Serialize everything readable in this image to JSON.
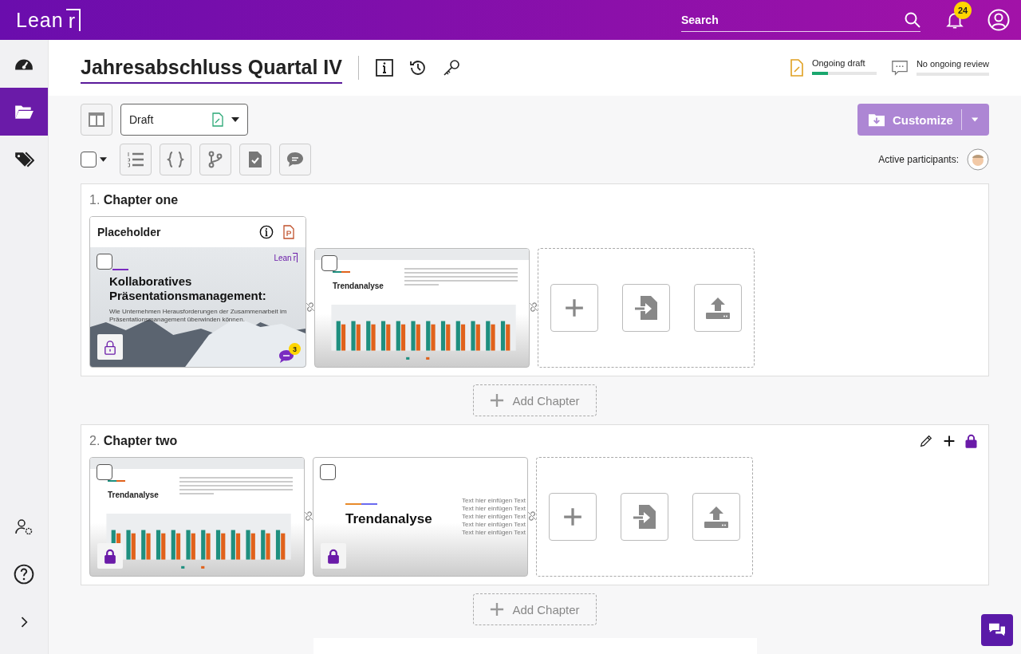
{
  "app": {
    "logo": "Lean",
    "logo_mark": "r"
  },
  "search": {
    "placeholder": "Search"
  },
  "notifications": {
    "count": "24"
  },
  "sidebar": {
    "items": [
      {
        "kind": "dashboard",
        "selected": false
      },
      {
        "kind": "folder",
        "selected": true
      },
      {
        "kind": "tags",
        "selected": false
      }
    ],
    "bottom": [
      {
        "kind": "user-settings"
      },
      {
        "kind": "help"
      },
      {
        "kind": "expand"
      }
    ]
  },
  "document": {
    "title": "Jahresabschluss Quartal IV"
  },
  "status": [
    {
      "kind": "draft",
      "label": "Ongoing draft",
      "level": 0.25
    },
    {
      "kind": "review",
      "label": "No ongoing review"
    }
  ],
  "toolbar": {
    "version": "Draft",
    "customize": "Customize",
    "participants_label": "Active participants:",
    "select_all_checked": false
  },
  "chapters": [
    {
      "number": "1.",
      "title": "Chapter one",
      "actions": false,
      "add_label": "Add Chapter",
      "slides": [
        {
          "kind": "title",
          "header": "Placeholder",
          "brand": "Lean",
          "brand_mark": "r",
          "title": "Kollaboratives Präsentationsmanagement:",
          "subtitle": "Wie Unternehmen Herausforderungen der Zusammenarbeit im Präsentationsmanagement überwinden können.",
          "checked": false,
          "locked": false,
          "comments": "3"
        },
        {
          "kind": "chart",
          "title": "Trendanalyse",
          "checked": false
        }
      ]
    },
    {
      "number": "2.",
      "title": "Chapter two",
      "actions": true,
      "locked": true,
      "add_label": "Add Chapter",
      "slides": [
        {
          "kind": "chart",
          "title": "Trendanalyse",
          "checked": false,
          "locked": true
        },
        {
          "kind": "text",
          "title": "Trendanalyse",
          "lines": [
            "Text hier einfügen Text",
            "Text hier einfügen Text",
            "Text hier einfügen Text",
            "Text hier einfügen Text",
            "Text hier einfügen Text"
          ],
          "checked": false,
          "locked": true
        }
      ]
    }
  ]
}
